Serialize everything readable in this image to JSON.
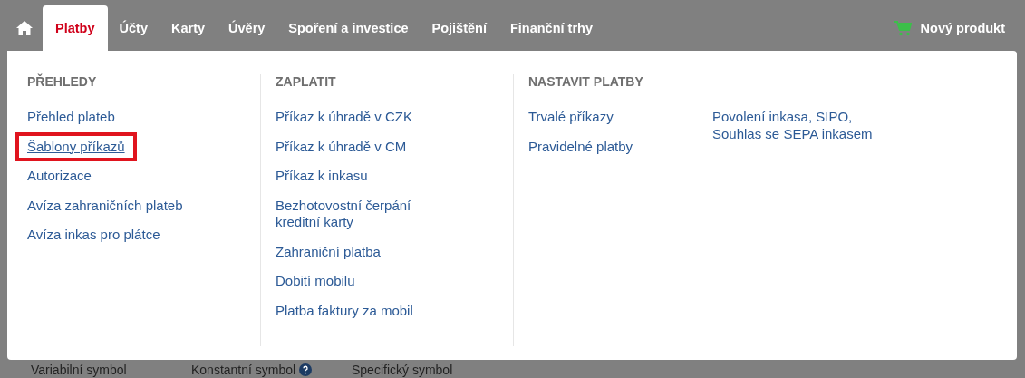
{
  "nav": {
    "tabs": [
      {
        "label": "Platby",
        "selected": true
      },
      {
        "label": "Účty",
        "selected": false
      },
      {
        "label": "Karty",
        "selected": false
      },
      {
        "label": "Úvěry",
        "selected": false
      },
      {
        "label": "Spoření a investice",
        "selected": false
      },
      {
        "label": "Pojištění",
        "selected": false
      },
      {
        "label": "Finanční trhy",
        "selected": false
      }
    ],
    "new_product": "Nový produkt"
  },
  "menu": {
    "columns": [
      {
        "heading": "PŘEHLEDY",
        "groups": [
          [
            {
              "label": "Přehled plateb",
              "highlighted": false
            },
            {
              "label": "Šablony příkazů",
              "highlighted": true
            },
            {
              "label": "Autorizace",
              "highlighted": false
            },
            {
              "label": "Avíza zahraničních plateb",
              "highlighted": false
            },
            {
              "label": "Avíza inkas pro plátce",
              "highlighted": false
            }
          ]
        ]
      },
      {
        "heading": "ZAPLATIT",
        "groups": [
          [
            {
              "label": "Příkaz k úhradě v CZK",
              "highlighted": false
            },
            {
              "label": "Příkaz k úhradě v CM",
              "highlighted": false
            },
            {
              "label": "Příkaz k inkasu",
              "highlighted": false
            },
            {
              "label": "Bezhotovostní čerpání kreditní karty",
              "highlighted": false
            },
            {
              "label": "Zahraniční platba",
              "highlighted": false
            },
            {
              "label": "Dobití mobilu",
              "highlighted": false
            },
            {
              "label": "Platba faktury za mobil",
              "highlighted": false
            }
          ]
        ]
      },
      {
        "heading": "NASTAVIT PLATBY",
        "groups": [
          [
            {
              "label": "Trvalé příkazy",
              "highlighted": false
            },
            {
              "label": "Pravidelné platby",
              "highlighted": false
            }
          ],
          [
            {
              "label": "Povolení inkasa, SIPO, Souhlas se SEPA inkasem",
              "highlighted": false
            }
          ]
        ]
      }
    ]
  },
  "form_labels": [
    {
      "label": "Variabilní symbol",
      "help": false
    },
    {
      "label": "Konstantní symbol",
      "help": true
    },
    {
      "label": "Specifický symbol",
      "help": false
    }
  ]
}
